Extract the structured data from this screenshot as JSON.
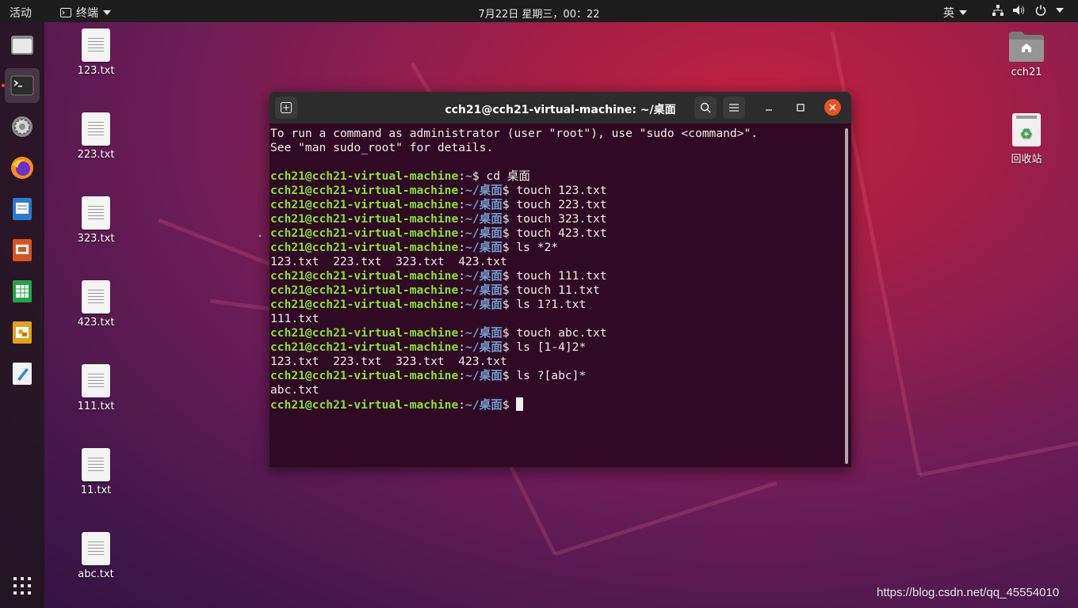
{
  "topbar": {
    "activities": "活动",
    "app_name": "终端",
    "clock": "7月22日 星期三，00：22",
    "input_method": "英"
  },
  "dock": {
    "items": [
      {
        "name": "files-icon"
      },
      {
        "name": "terminal-icon"
      },
      {
        "name": "settings-icon"
      },
      {
        "name": "firefox-icon"
      },
      {
        "name": "writer-icon"
      },
      {
        "name": "impress-icon"
      },
      {
        "name": "calc-icon"
      },
      {
        "name": "draw-icon"
      },
      {
        "name": "text-editor-icon"
      }
    ]
  },
  "desktop": {
    "files": [
      "123.txt",
      "223.txt",
      "323.txt",
      "423.txt",
      "111.txt",
      "11.txt",
      "abc.txt"
    ],
    "home_label": "cch21",
    "trash_label": "回收站"
  },
  "terminal": {
    "title": "cch21@cch21-virtual-machine: ~/桌面",
    "lines": [
      {
        "type": "text",
        "text": "To run a command as administrator (user \"root\"), use \"sudo <command>\"."
      },
      {
        "type": "text",
        "text": "See \"man sudo_root\" for details."
      },
      {
        "type": "text",
        "text": ""
      },
      {
        "type": "prompt",
        "user": "cch21@cch21-virtual-machine",
        "path": "~",
        "cmd": " cd 桌面"
      },
      {
        "type": "prompt",
        "user": "cch21@cch21-virtual-machine",
        "path": "~/桌面",
        "cmd": " touch 123.txt"
      },
      {
        "type": "prompt",
        "user": "cch21@cch21-virtual-machine",
        "path": "~/桌面",
        "cmd": " touch 223.txt"
      },
      {
        "type": "prompt",
        "user": "cch21@cch21-virtual-machine",
        "path": "~/桌面",
        "cmd": " touch 323.txt"
      },
      {
        "type": "prompt",
        "user": "cch21@cch21-virtual-machine",
        "path": "~/桌面",
        "cmd": " touch 423.txt"
      },
      {
        "type": "prompt",
        "user": "cch21@cch21-virtual-machine",
        "path": "~/桌面",
        "cmd": " ls *2*"
      },
      {
        "type": "text",
        "text": "123.txt  223.txt  323.txt  423.txt"
      },
      {
        "type": "prompt",
        "user": "cch21@cch21-virtual-machine",
        "path": "~/桌面",
        "cmd": " touch 111.txt"
      },
      {
        "type": "prompt",
        "user": "cch21@cch21-virtual-machine",
        "path": "~/桌面",
        "cmd": " touch 11.txt"
      },
      {
        "type": "prompt",
        "user": "cch21@cch21-virtual-machine",
        "path": "~/桌面",
        "cmd": " ls 1?1.txt"
      },
      {
        "type": "text",
        "text": "111.txt"
      },
      {
        "type": "prompt",
        "user": "cch21@cch21-virtual-machine",
        "path": "~/桌面",
        "cmd": " touch abc.txt"
      },
      {
        "type": "prompt",
        "user": "cch21@cch21-virtual-machine",
        "path": "~/桌面",
        "cmd": " ls [1-4]2*"
      },
      {
        "type": "text",
        "text": "123.txt  223.txt  323.txt  423.txt"
      },
      {
        "type": "prompt",
        "user": "cch21@cch21-virtual-machine",
        "path": "~/桌面",
        "cmd": " ls ?[abc]*"
      },
      {
        "type": "text",
        "text": "abc.txt"
      },
      {
        "type": "prompt",
        "user": "cch21@cch21-virtual-machine",
        "path": "~/桌面",
        "cmd": " ",
        "cursor": true
      }
    ]
  },
  "watermark": "https://blog.csdn.net/qq_45554010",
  "colors": {
    "accent": "#e95420",
    "terminal_bg": "#300a24",
    "prompt_user": "#8ae234",
    "prompt_path": "#729fcf"
  }
}
